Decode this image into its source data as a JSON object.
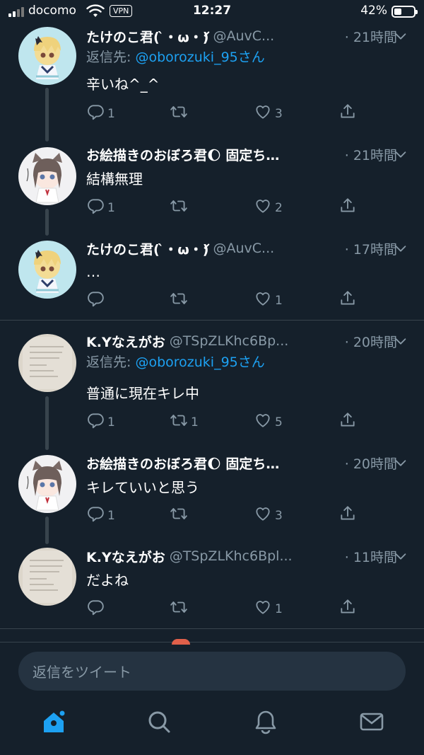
{
  "status_bar": {
    "carrier": "docomo",
    "vpn_label": "VPN",
    "time": "12:27",
    "battery_percent": "42%",
    "battery_level": 0.42
  },
  "colors": {
    "background": "#15202b",
    "secondary_text": "#8899a6",
    "link": "#1da1f2",
    "divider": "#38444d"
  },
  "tweets": [
    {
      "display_name": "たけのこ君( ̀・ω・́)",
      "handle": "@AuvC...",
      "time": "· 21時間",
      "reply_prefix": "返信先: ",
      "reply_mention": "@oborozuki_95さん",
      "text": "辛いね^_^",
      "replies": "1",
      "retweets": "",
      "likes": "3",
      "avatar": "anime-girl-avatar"
    },
    {
      "display_name": "お絵描きのおぼろ君🌔 固定ち…",
      "handle": "",
      "time": "· 21時間",
      "text": "結構無理",
      "replies": "1",
      "retweets": "",
      "likes": "2",
      "avatar": "cat-ear-girl-avatar"
    },
    {
      "display_name": "たけのこ君( ̀・ω・́)",
      "handle": "@AuvC...",
      "time": "· 17時間",
      "text": "…",
      "replies": "",
      "retweets": "",
      "likes": "1",
      "avatar": "anime-girl-avatar"
    },
    {
      "display_name": "K.Yなえがお",
      "handle": "@TSpZLKhc6Bp...",
      "time": "· 20時間",
      "reply_prefix": "返信先: ",
      "reply_mention": "@oborozuki_95さん",
      "text": "普通に現在キレ中",
      "replies": "1",
      "retweets": "1",
      "likes": "5",
      "avatar": "paper-note-avatar"
    },
    {
      "display_name": "お絵描きのおぼろ君🌔 固定ち…",
      "handle": "",
      "time": "· 20時間",
      "text": "キレていいと思う",
      "replies": "1",
      "retweets": "",
      "likes": "3",
      "avatar": "cat-ear-girl-avatar"
    },
    {
      "display_name": "K.Yなえがお",
      "handle": "@TSpZLKhc6Bpl...",
      "time": "· 11時間",
      "text": "だよね",
      "replies": "",
      "retweets": "",
      "likes": "1",
      "avatar": "paper-note-avatar"
    }
  ],
  "reply_bar": {
    "placeholder": "返信をツイート"
  },
  "tab_bar": {
    "icons": [
      "home-icon",
      "search-icon",
      "notifications-icon",
      "messages-icon"
    ],
    "active": "home-icon"
  }
}
